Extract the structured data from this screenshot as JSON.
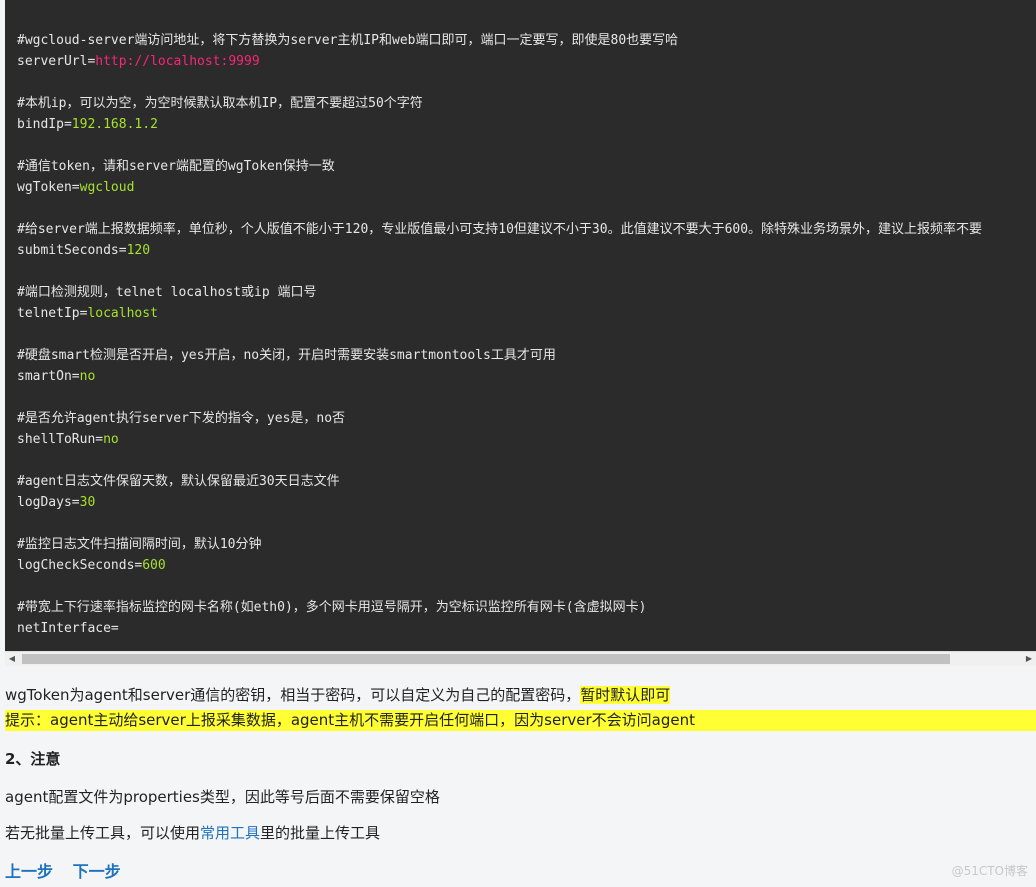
{
  "code": {
    "blocks": [
      {
        "comment": "#wgcloud-server端访问地址，将下方替换为server主机IP和web端口即可，端口一定要写，即使是80也要写哈",
        "key": "serverUrl",
        "value": "http://localhost:9999",
        "value_color": "red"
      },
      {
        "comment": "#本机ip，可以为空，为空时候默认取本机IP，配置不要超过50个字符",
        "key": "bindIp",
        "value": "192.168.1.2",
        "value_color": "green"
      },
      {
        "comment": "#通信token，请和server端配置的wgToken保持一致",
        "key": "wgToken",
        "value": "wgcloud",
        "value_color": "green"
      },
      {
        "comment": "#给server端上报数据频率，单位秒，个人版值不能小于120，专业版值最小可支持10但建议不小于30。此值建议不要大于600。除特殊业务场景外，建议上报频率不要",
        "key": "submitSeconds",
        "value": "120",
        "value_color": "green"
      },
      {
        "comment": "#端口检测规则，telnet localhost或ip 端口号",
        "key": "telnetIp",
        "value": "localhost",
        "value_color": "green"
      },
      {
        "comment": "#硬盘smart检测是否开启，yes开启，no关闭，开启时需要安装smartmontools工具才可用",
        "key": "smartOn",
        "value": "no",
        "value_color": "green"
      },
      {
        "comment": "#是否允许agent执行server下发的指令，yes是，no否",
        "key": "shellToRun",
        "value": "no",
        "value_color": "green"
      },
      {
        "comment": "#agent日志文件保留天数，默认保留最近30天日志文件",
        "key": "logDays",
        "value": "30",
        "value_color": "green"
      },
      {
        "comment": "#监控日志文件扫描间隔时间，默认10分钟",
        "key": "logCheckSeconds",
        "value": "600",
        "value_color": "green"
      },
      {
        "comment": "#带宽上下行速率指标监控的网卡名称(如eth0)，多个网卡用逗号隔开，为空标识监控所有网卡(含虚拟网卡)",
        "key": "netInterface",
        "value": "",
        "value_color": "green"
      }
    ]
  },
  "article": {
    "p1_text": "wgToken为agent和server通信的密钥，相当于密码，可以自定义为自己的配置密码，",
    "p1_highlight": "暂时默认即可",
    "tip": "提示：agent主动给server上报采集数据，agent主机不需要开启任何端口，因为server不会访问agent",
    "heading": "2、注意",
    "p2": "agent配置文件为properties类型，因此等号后面不需要保留空格",
    "p3_before": "若无批量上传工具，可以使用",
    "p3_link": "常用工具",
    "p3_after": "里的批量上传工具",
    "prev": "上一步",
    "next": "下一步"
  },
  "scrollbar": {
    "left_arrow": "◀",
    "right_arrow": "▶"
  },
  "watermark": "@51CTO博客",
  "colors": {
    "code_bg": "#2b2b2b",
    "value_green": "#a6e22e",
    "value_red": "#f92672",
    "highlight": "#ffff33",
    "link": "#1e73be"
  }
}
